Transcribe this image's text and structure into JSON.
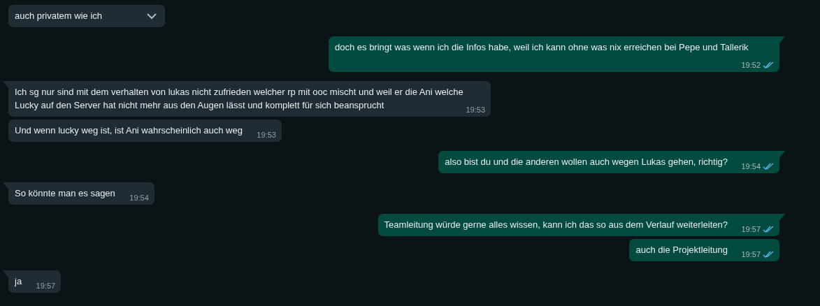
{
  "messages": [
    {
      "kind": "incoming",
      "text": "auch privatem wie ich",
      "tail": false,
      "menu_shown": true
    },
    {
      "kind": "outgoing",
      "text": "doch es bringt was wenn ich die Infos habe, weil ich kann ohne was nix erreichen bei Pepe und Tallerik",
      "time": "19:52",
      "tail": true,
      "read": true
    },
    {
      "kind": "incoming",
      "text": "Ich sg nur sind mit dem verhalten von lukas nicht zufrieden welcher rp mit ooc mischt und weil er die Ani welche Lucky auf den Server hat nicht mehr aus den Augen lässt und komplett für sich beansprucht",
      "time": "19:53",
      "tail": true
    },
    {
      "kind": "incoming",
      "text": "Und wenn lucky weg ist, ist Ani wahrscheinlich auch weg",
      "time": "19:53",
      "tail": false
    },
    {
      "kind": "outgoing",
      "text": "also bist du und die anderen wollen auch wegen Lukas gehen, richtig?",
      "time": "19:54",
      "tail": true,
      "read": true
    },
    {
      "kind": "incoming",
      "text": "So könnte man es sagen",
      "time": "19:54",
      "tail": true
    },
    {
      "kind": "outgoing",
      "text": "Teamleitung würde gerne alles wissen, kann ich das so aus dem Verlauf weiterleiten?",
      "time": "19:57",
      "tail": true,
      "read": true
    },
    {
      "kind": "outgoing",
      "text": "auch die Projektleitung",
      "time": "19:57",
      "tail": false,
      "read": true
    },
    {
      "kind": "incoming",
      "text": "ja",
      "time": "19:57",
      "tail": true
    }
  ]
}
